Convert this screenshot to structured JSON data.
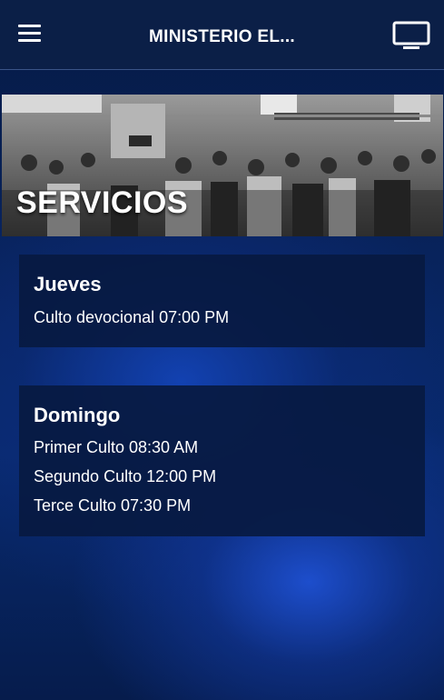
{
  "header": {
    "title": "MINISTERIO EL..."
  },
  "banner": {
    "title": "SERVICIOS"
  },
  "services": [
    {
      "day": "Jueves",
      "items": [
        "Culto devocional 07:00 PM"
      ]
    },
    {
      "day": "Domingo",
      "items": [
        "Primer Culto 08:30 AM",
        "Segundo Culto 12:00 PM",
        "Terce Culto 07:30 PM"
      ]
    }
  ],
  "icons": {
    "menu": "menu-icon",
    "cast": "tv-icon"
  },
  "colors": {
    "topbar": "#0b1f47",
    "card": "#071a42",
    "background": "#082a6e"
  }
}
